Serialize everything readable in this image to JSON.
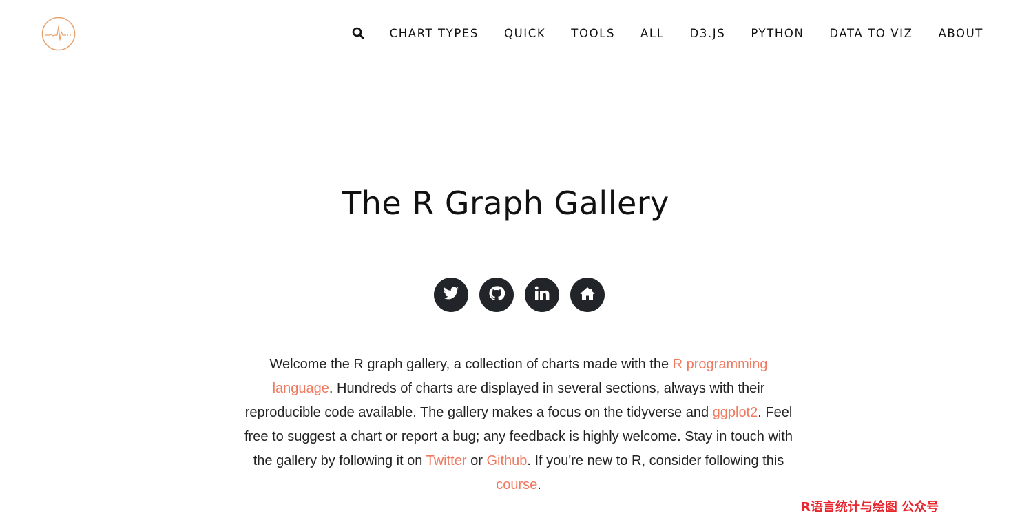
{
  "colors": {
    "accent": "#f0795f",
    "logo": "#e8a06b",
    "social_bg": "#212529",
    "text": "#222222",
    "watermark": "#e8262d"
  },
  "navbar": {
    "logo_icon": "heartbeat-logo-icon",
    "search_icon": "search-icon",
    "items": [
      {
        "label": "CHART TYPES"
      },
      {
        "label": "QUICK"
      },
      {
        "label": "TOOLS"
      },
      {
        "label": "ALL"
      },
      {
        "label": "D3.JS"
      },
      {
        "label": "PYTHON"
      },
      {
        "label": "DATA TO VIZ"
      },
      {
        "label": "ABOUT"
      }
    ]
  },
  "hero": {
    "title": "The R Graph Gallery",
    "social": [
      {
        "icon": "twitter-icon"
      },
      {
        "icon": "github-icon"
      },
      {
        "icon": "linkedin-icon"
      },
      {
        "icon": "home-icon"
      }
    ]
  },
  "intro": {
    "t1": "Welcome the R graph gallery, a collection of charts made with the ",
    "link_r": "R programming language",
    "t2": ". Hundreds of charts are displayed in several sections, always with their reproducible code available. The gallery makes a focus on the tidyverse and ",
    "link_ggplot": "ggplot2",
    "t3": ". Feel free to suggest a chart or report a bug; any feedback is highly welcome. Stay in touch with the gallery by following it on ",
    "link_twitter": "Twitter",
    "t4": " or ",
    "link_github": "Github",
    "t5": ". If you're new to R, consider following this ",
    "link_course": "course",
    "t6": "."
  },
  "watermark": "R语言统计与绘图 公众号"
}
